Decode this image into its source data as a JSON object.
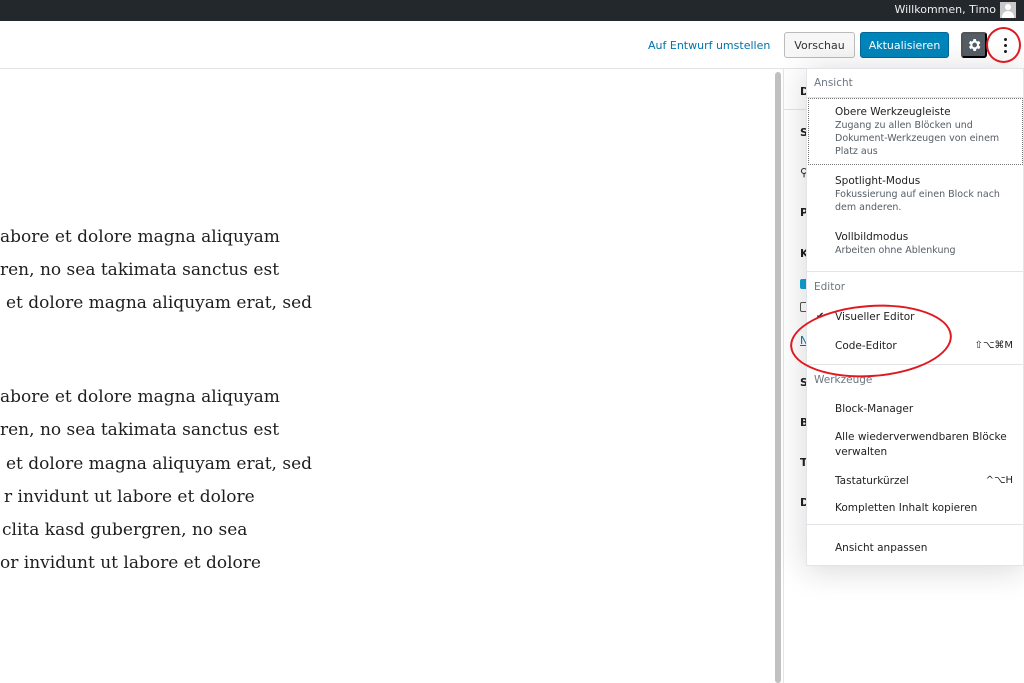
{
  "adminbar": {
    "welcome": "Willkommen, Timo"
  },
  "header": {
    "draft_link": "Auf Entwurf umstellen",
    "preview": "Vorschau",
    "update": "Aktualisieren"
  },
  "content": {
    "lines": [
      "abore et dolore magna aliquyam",
      "ren, no sea takimata sanctus est",
      "et dolore magna aliquyam erat, sed",
      "abore et dolore magna aliquyam",
      "ren, no sea takimata sanctus est",
      "et dolore magna aliquyam erat, sed",
      "r invidunt ut labore et dolore",
      "clita kasd gubergren, no sea",
      "or invidunt ut labore et dolore"
    ]
  },
  "sidebar": {
    "letters": [
      "D",
      "S",
      "P",
      "K",
      "S",
      "B",
      "T",
      "D"
    ],
    "link_letter": "N"
  },
  "menu": {
    "view_label": "Ansicht",
    "top_toolbar": {
      "title": "Obere Werkzeugleiste",
      "desc": "Zugang zu allen Blöcken und Dokument-Werkzeugen von einem Platz aus"
    },
    "spotlight": {
      "title": "Spotlight-Modus",
      "desc": "Fokussierung auf einen Block nach dem anderen."
    },
    "fullscreen": {
      "title": "Vollbildmodus",
      "desc": "Arbeiten ohne Ablenkung"
    },
    "editor_label": "Editor",
    "visual_editor": "Visueller Editor",
    "code_editor": "Code-Editor",
    "code_editor_shortcut": "⇧⌥⌘M",
    "tools_label": "Werkzeuge",
    "block_manager": "Block-Manager",
    "reusable_blocks": "Alle wiederverwendbaren Blöcke verwalten",
    "keyboard_shortcuts": "Tastaturkürzel",
    "keyboard_shortcuts_key": "^⌥H",
    "copy_all": "Kompletten Inhalt kopieren",
    "customize_view": "Ansicht anpassen"
  },
  "colors": {
    "adminbar": "#23282d",
    "primary_button": "#0085ba",
    "link": "#0073aa",
    "annotation": "#e0181f"
  }
}
